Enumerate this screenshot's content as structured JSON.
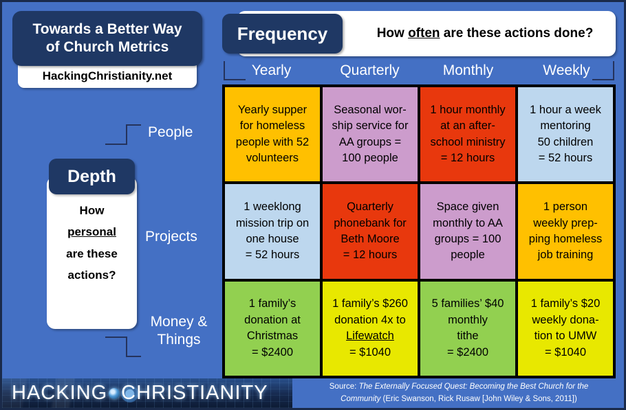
{
  "title": {
    "heading": "Towards a Better Way of Church Metrics",
    "heading_line1": "Towards a Better Way",
    "heading_line2": "of Church Metrics",
    "site": "HackingChristianity.net"
  },
  "frequency": {
    "badge": "Frequency",
    "question_pre": "How ",
    "question_emphasis": "often",
    "question_post": " are these actions done?",
    "question_full": "How often are these actions done?",
    "columns": [
      "Yearly",
      "Quarterly",
      "Monthly",
      "Weekly"
    ]
  },
  "depth": {
    "badge": "Depth",
    "question_line1": "How",
    "question_emphasis": "personal",
    "question_line3": "are these",
    "question_line4": "actions?",
    "question_full": "How personal are these actions?",
    "rows": [
      "People",
      "Projects",
      "Money & Things"
    ],
    "row_money_line1": "Money &",
    "row_money_line2": "Things"
  },
  "colors": {
    "background": "#4470c4",
    "navy": "#1f3864",
    "gold": "#ffc000",
    "purple": "#cc9ccc",
    "red": "#e8380d",
    "lightblue": "#bdd7ee",
    "green": "#92d050",
    "yellow": "#e8e800",
    "grid_border": "#000000",
    "bracket": "#25335c"
  },
  "grid": {
    "rows": [
      {
        "label": "People",
        "cells": [
          {
            "text": "Yearly supper for homeless people with 52 volunteers",
            "color": "#ffc000"
          },
          {
            "text": "Seasonal wor-ship service for AA groups = 100 people",
            "color": "#cc9ccc"
          },
          {
            "text": "1 hour monthly at an after-school ministry = 12 hours",
            "color": "#e8380d"
          },
          {
            "text": "1 hour a week mentoring 50 children = 52 hours",
            "color": "#bdd7ee"
          }
        ]
      },
      {
        "label": "Projects",
        "cells": [
          {
            "text": "1 weeklong mission trip on one house = 52 hours",
            "color": "#bdd7ee"
          },
          {
            "text": "Quarterly phonebank for Beth Moore = 12 hours",
            "color": "#e8380d"
          },
          {
            "text": "Space given monthly to AA groups = 100 people",
            "color": "#cc9ccc"
          },
          {
            "text": "1 person weekly prep-ping homeless job training",
            "color": "#ffc000"
          }
        ]
      },
      {
        "label": "Money & Things",
        "cells": [
          {
            "text": "1 family’s donation at Christmas = $2400",
            "color": "#92d050"
          },
          {
            "text": "1 family’s $260 donation 4x to Lifewatch = $1040",
            "color": "#e8e800"
          },
          {
            "text": "5 families’ $40 monthly tithe = $2400",
            "color": "#92d050"
          },
          {
            "text": "1 family’s $20 weekly dona-tion to UMW = $1040",
            "color": "#e8e800"
          }
        ]
      }
    ],
    "cell_lines": [
      [
        [
          "Yearly supper",
          "for homeless",
          "people with 52",
          "volunteers"
        ],
        [
          "Seasonal wor-",
          "ship service for",
          "AA groups =",
          "100 people"
        ],
        [
          "1 hour monthly",
          "at an after-",
          "school ministry",
          "= 12 hours"
        ],
        [
          "1 hour a week",
          "mentoring",
          "50 children",
          "= 52 hours"
        ]
      ],
      [
        [
          "1 weeklong",
          "mission trip on",
          "one house",
          "= 52 hours"
        ],
        [
          "Quarterly",
          "phonebank for",
          "Beth Moore",
          "= 12 hours"
        ],
        [
          "Space given",
          "monthly to AA",
          "groups = 100",
          "people"
        ],
        [
          "1 person",
          "weekly prep-",
          "ping homeless",
          "job training"
        ]
      ],
      [
        [
          "1 family’s",
          "donation at",
          "Christmas",
          "= $2400"
        ],
        [
          "1 family’s $260",
          "donation 4x to",
          "Lifewatch",
          "= $1040"
        ],
        [
          "5 families’ $40",
          "monthly",
          "tithe",
          "= $2400"
        ],
        [
          "1 family’s $20",
          "weekly dona-",
          "tion to UMW",
          "= $1040"
        ]
      ]
    ]
  },
  "footer": {
    "logo_part1": "HACKING",
    "logo_part2": "CHRISTIANITY",
    "source_prefix": "Source: ",
    "source_title_line1": "The Externally Focused Quest: Becoming the Best Church for the",
    "source_title_line2": "Community",
    "source_credit": " (Eric Swanson, Rick Rusaw [John Wiley & Sons, 2011])",
    "source_full": "Source: The Externally Focused Quest: Becoming the Best Church for the Community (Eric Swanson, Rick Rusaw [John Wiley & Sons, 2011])"
  }
}
